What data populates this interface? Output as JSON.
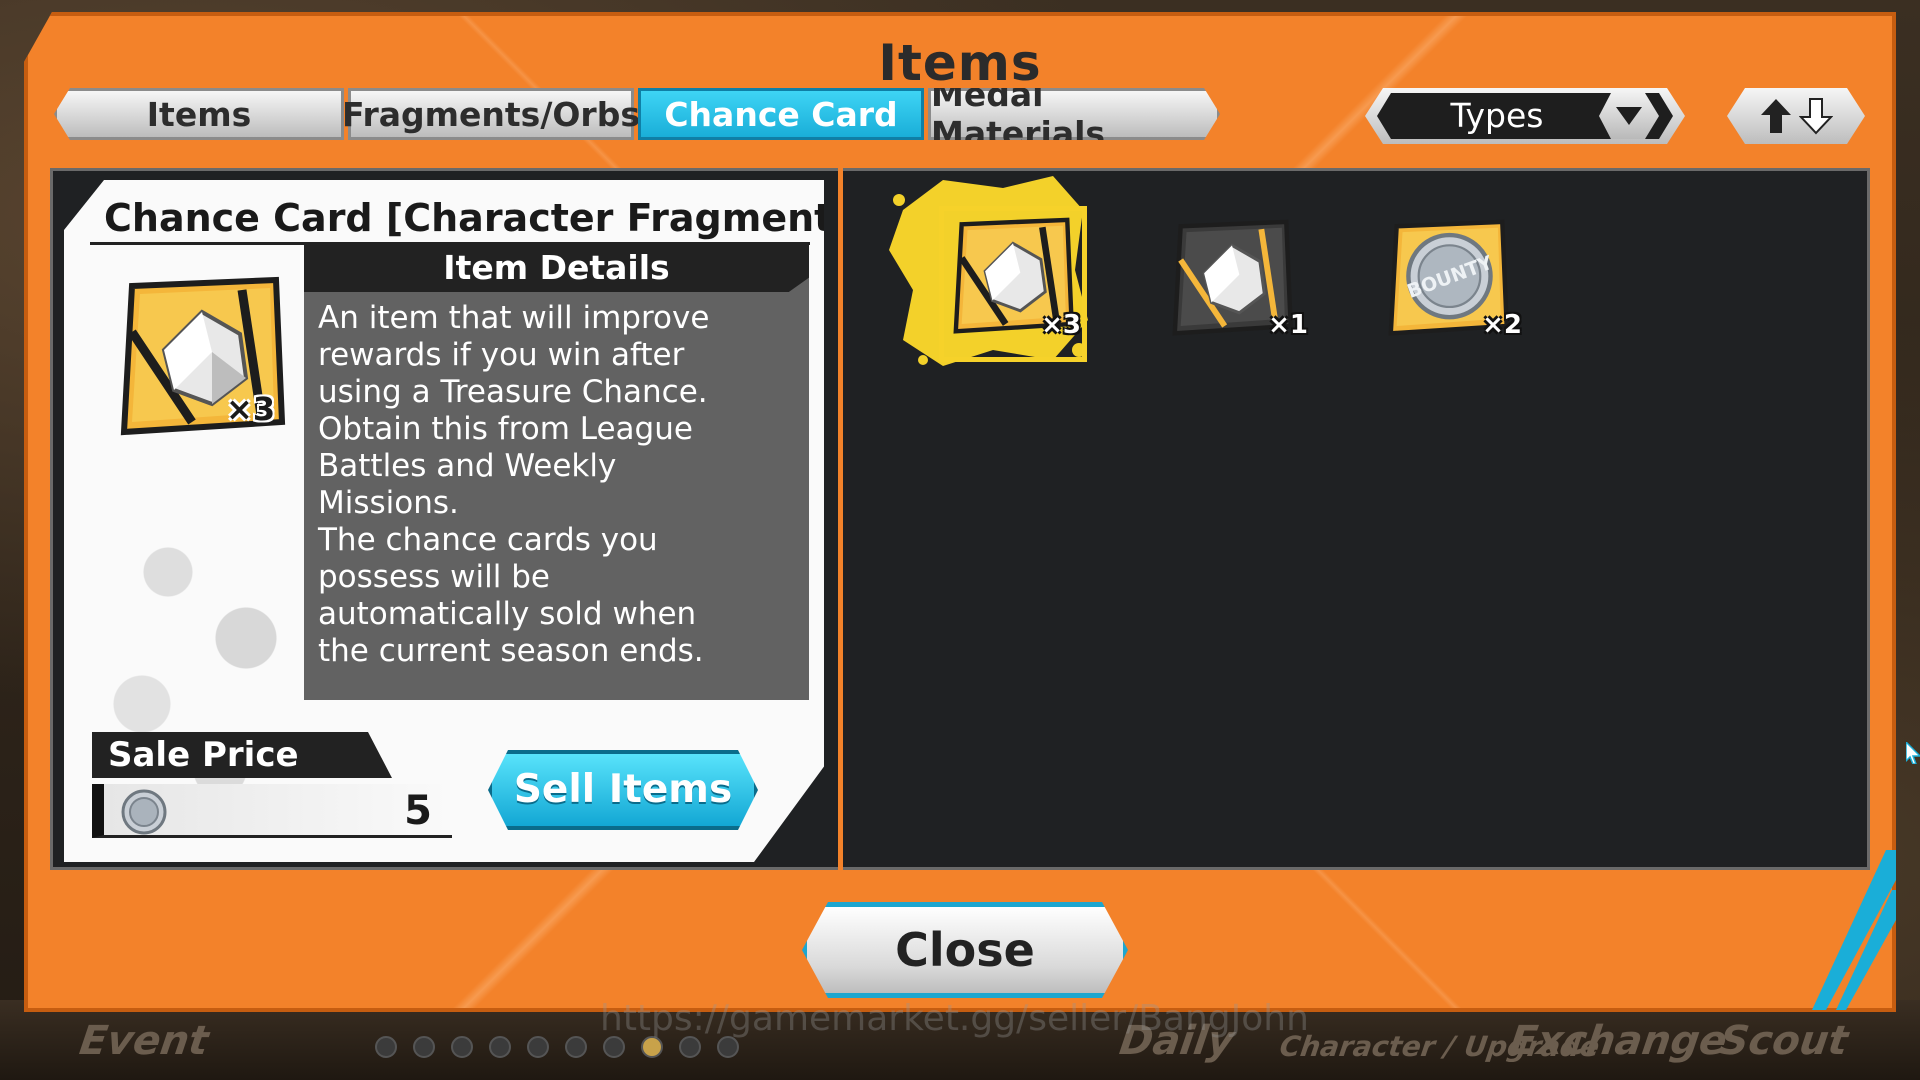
{
  "modal": {
    "title": "Items"
  },
  "tabs": [
    {
      "label": "Items",
      "active": false
    },
    {
      "label": "Fragments/Orbs",
      "active": false
    },
    {
      "label": "Chance Card",
      "active": true
    },
    {
      "label": "Medal Materials",
      "active": false
    }
  ],
  "filter": {
    "types_label": "Types",
    "types_icon": "chevron-down-icon",
    "sort_icon": "sort-up-down-icon"
  },
  "detail": {
    "title": "Chance Card [Character Fragment]",
    "quantity": "×3",
    "details_heading": "Item Details",
    "description": "An item that will improve\nrewards if you win after\nusing a Treasure Chance.\nObtain this from League\nBattles and Weekly\nMissions.\nThe chance cards you\npossess will be\nautomatically sold when\nthe current season ends.",
    "sale_price_label": "Sale Price",
    "sale_price_value": "5",
    "sell_button": "Sell Items"
  },
  "grid_items": [
    {
      "kind": "chance-card-character-fragment",
      "quantity": "×3",
      "selected": true,
      "bounty_text": ""
    },
    {
      "kind": "chance-card-dark-fragment",
      "quantity": "×1",
      "selected": false,
      "bounty_text": ""
    },
    {
      "kind": "chance-card-bounty-coin",
      "quantity": "×2",
      "selected": false,
      "bounty_text": "BOUNTY"
    }
  ],
  "close_button": "Close",
  "bottom_nav": [
    {
      "label": "Event"
    },
    {
      "label": "Daily"
    },
    {
      "label": "Character / Upgrade"
    },
    {
      "label": "Exchange"
    },
    {
      "label": "Scout"
    }
  ],
  "watermark": "https://gamemarket.gg/seller/BangJohn",
  "colors": {
    "modal_orange": "#f3822a",
    "active_tab_cyan": "#1aaed8",
    "panel_dark": "#1f2123",
    "selected_gold": "#f6d22a"
  }
}
